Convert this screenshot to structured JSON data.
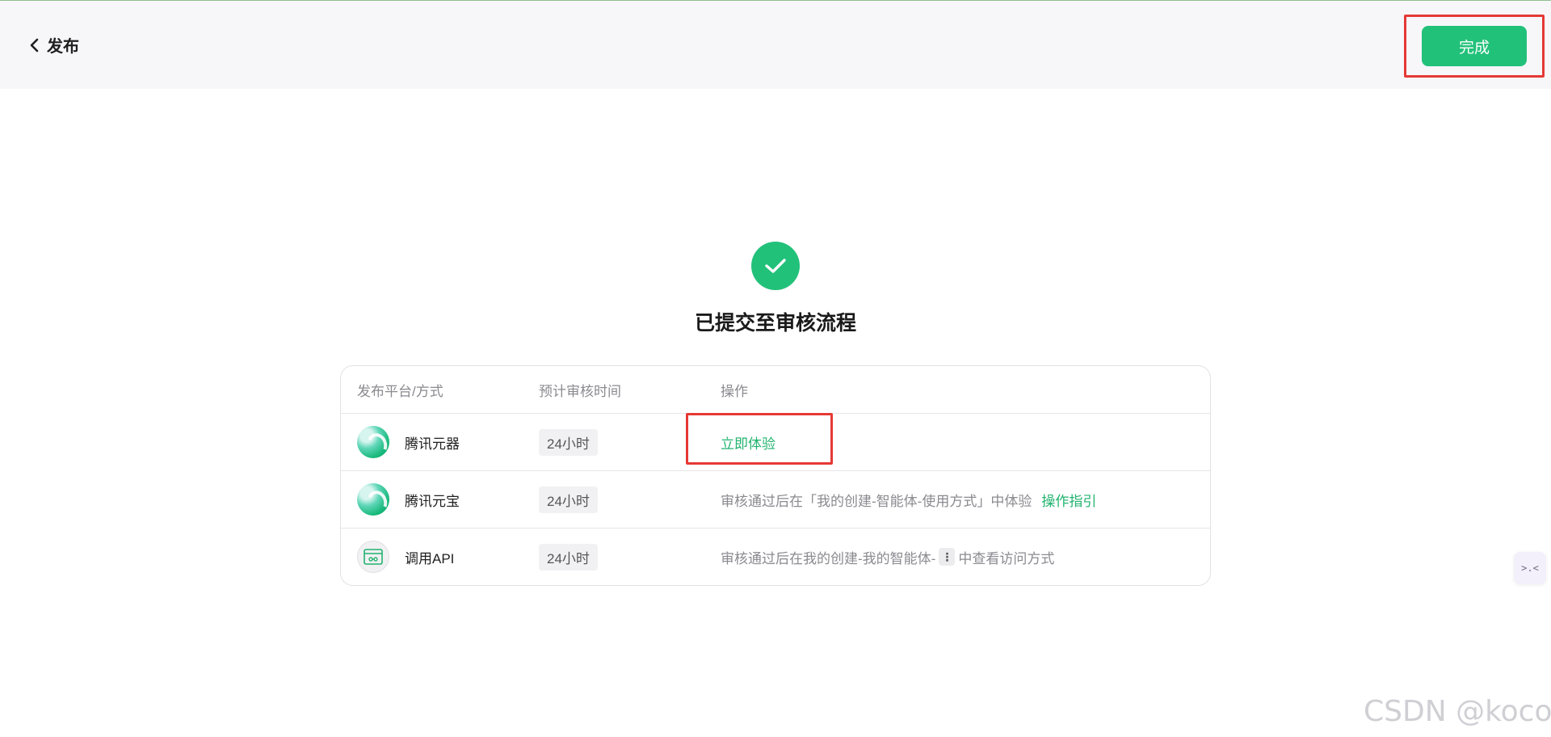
{
  "header": {
    "back_label": "发布",
    "done_label": "完成"
  },
  "status": {
    "title": "已提交至审核流程"
  },
  "table": {
    "columns": [
      "发布平台/方式",
      "预计审核时间",
      "操作"
    ],
    "rows": [
      {
        "platform": "腾讯元器",
        "icon": "yuanqi-logo-icon",
        "review_time": "24小时",
        "action_link": "立即体验"
      },
      {
        "platform": "腾讯元宝",
        "icon": "yuanbao-logo-icon",
        "review_time": "24小时",
        "action_text": "审核通过后在「我的创建-智能体-使用方式」中体验",
        "action_link": "操作指引"
      },
      {
        "platform": "调用API",
        "icon": "api-icon",
        "review_time": "24小时",
        "action_text_before": "审核通过后在我的创建-我的智能体-",
        "action_text_after": "中查看访问方式",
        "more_glyph": "⋮"
      }
    ]
  },
  "floating_tool": {
    "glyph": ">.<"
  },
  "watermark": "CSDN @kocor",
  "colors": {
    "accent": "#22c17a",
    "link": "#22b36f",
    "highlight": "#e53935",
    "topbar_bg": "#f7f7fa"
  }
}
